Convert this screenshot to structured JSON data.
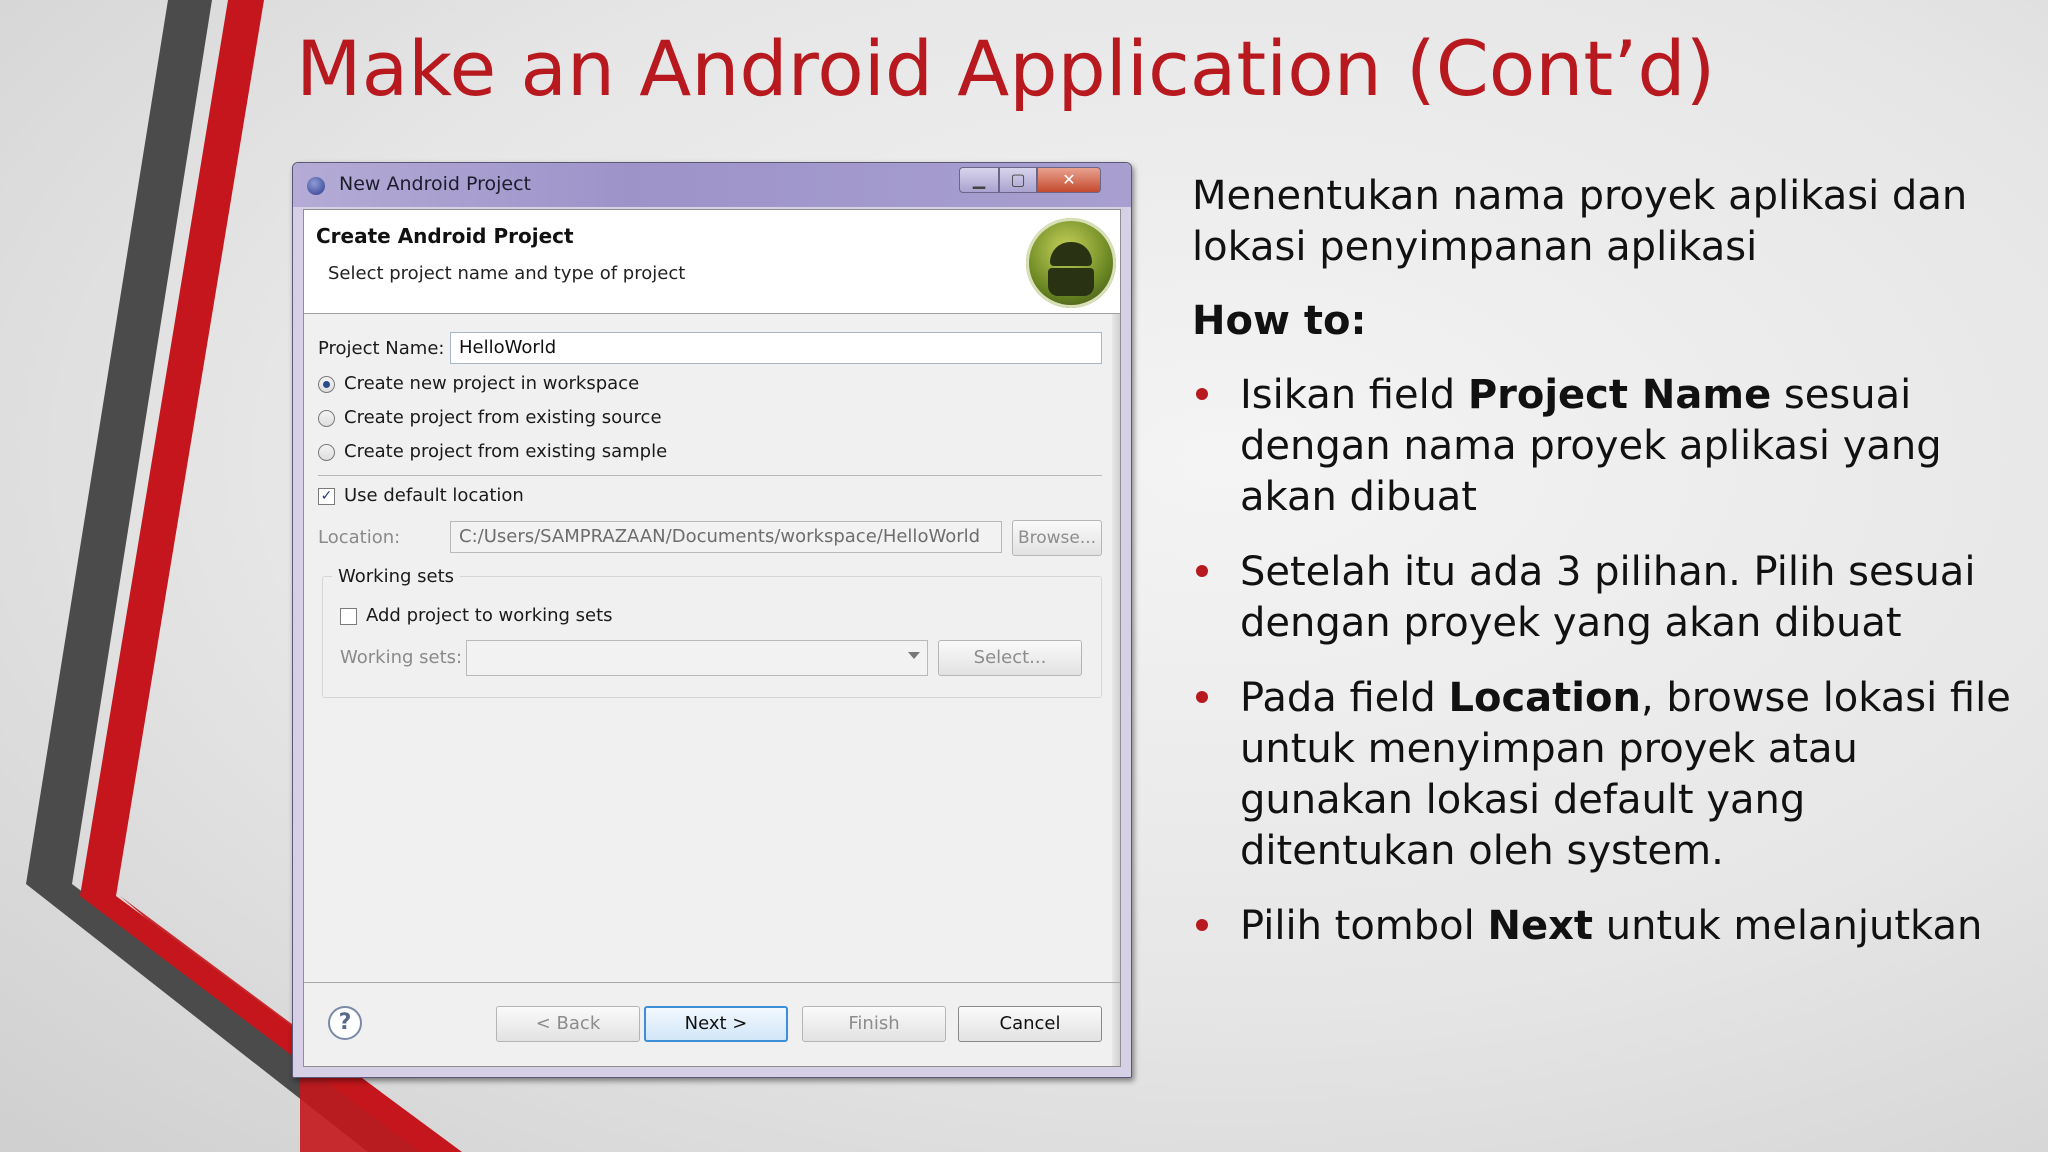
{
  "slide": {
    "title": "Make an Android Application (Cont’d)",
    "colors": {
      "accent": "#b7191f",
      "dark": "#4a4a4a"
    }
  },
  "dialog": {
    "window_title": "New Android Project",
    "header_title": "Create Android Project",
    "header_subtitle": "Select project name and type of project",
    "project_name_label": "Project Name:",
    "project_name_value": "HelloWorld",
    "options": [
      {
        "label": "Create new project in workspace",
        "selected": true
      },
      {
        "label": "Create project from existing source",
        "selected": false
      },
      {
        "label": "Create project from existing sample",
        "selected": false
      }
    ],
    "use_default_location_label": "Use default location",
    "use_default_location_checked": true,
    "location_label": "Location:",
    "location_value": "C:/Users/SAMPRAZAAN/Documents/workspace/HelloWorld",
    "browse_label": "Browse...",
    "working_sets_group_label": "Working sets",
    "add_to_working_sets_label": "Add project to working sets",
    "add_to_working_sets_checked": false,
    "working_sets_label": "Working sets:",
    "working_sets_value": "",
    "select_label": "Select...",
    "back_label": "< Back",
    "next_label": "Next >",
    "finish_label": "Finish",
    "cancel_label": "Cancel",
    "help_glyph": "?"
  },
  "explanation": {
    "intro": "Menentukan nama proyek aplikasi dan lokasi penyimpanan aplikasi",
    "howto": "How to:",
    "bullets": [
      {
        "pre": "Isikan field ",
        "bold": "Project Name",
        "post": " sesuai dengan nama proyek aplikasi yang akan dibuat"
      },
      {
        "pre": "Setelah itu ada 3 pilihan. Pilih sesuai dengan proyek yang akan dibuat",
        "bold": "",
        "post": ""
      },
      {
        "pre": "Pada field ",
        "bold": "Location",
        "post": ", browse lokasi file untuk menyimpan proyek atau gunakan lokasi default yang ditentukan oleh system."
      },
      {
        "pre": "Pilih tombol ",
        "bold": "Next",
        "post": " untuk melanjutkan"
      }
    ]
  }
}
